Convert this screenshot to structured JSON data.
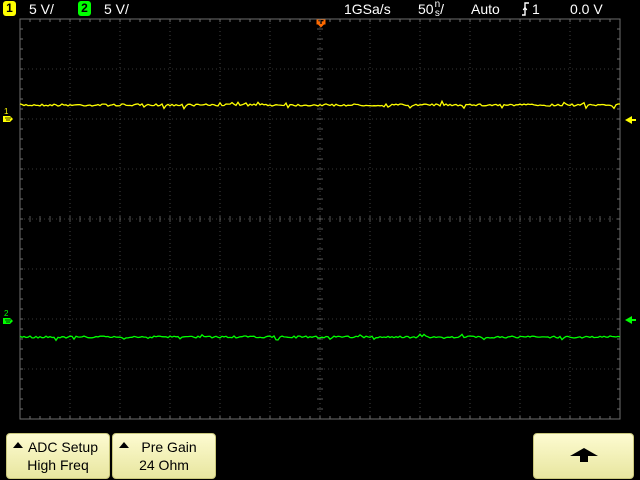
{
  "status": {
    "ch1": {
      "number": "1",
      "scale": "5 V/",
      "color": "#ffff00"
    },
    "ch2": {
      "number": "2",
      "scale": "5 V/",
      "color": "#00ff00"
    },
    "sample_rate": "1GSa/s",
    "timebase_value": "50",
    "timebase_unit_top": "n",
    "timebase_unit_bottom": "s",
    "timebase_slash": "/",
    "trigger_mode": "Auto",
    "trigger_icon": "rising-edge-icon",
    "trigger_source": "1",
    "trigger_level": "0.0 V"
  },
  "markers": {
    "ch1_label": "1",
    "ch2_label": "2",
    "trigger_position_icon": "trigger-position-icon"
  },
  "softkeys": [
    {
      "line1": "ADC Setup",
      "line2": "High Freq",
      "icon": "triangle-up-icon"
    },
    {
      "line1": "Pre Gain",
      "line2": "24 Ohm",
      "icon": "triangle-up-icon"
    },
    {
      "icon": "up-arrow-icon"
    }
  ],
  "colors": {
    "grid": "#6e6e6e",
    "ch1": "#ffff00",
    "ch2": "#00ff00",
    "trigger": "#ff6a00",
    "softkey": "#f4f2b8"
  }
}
